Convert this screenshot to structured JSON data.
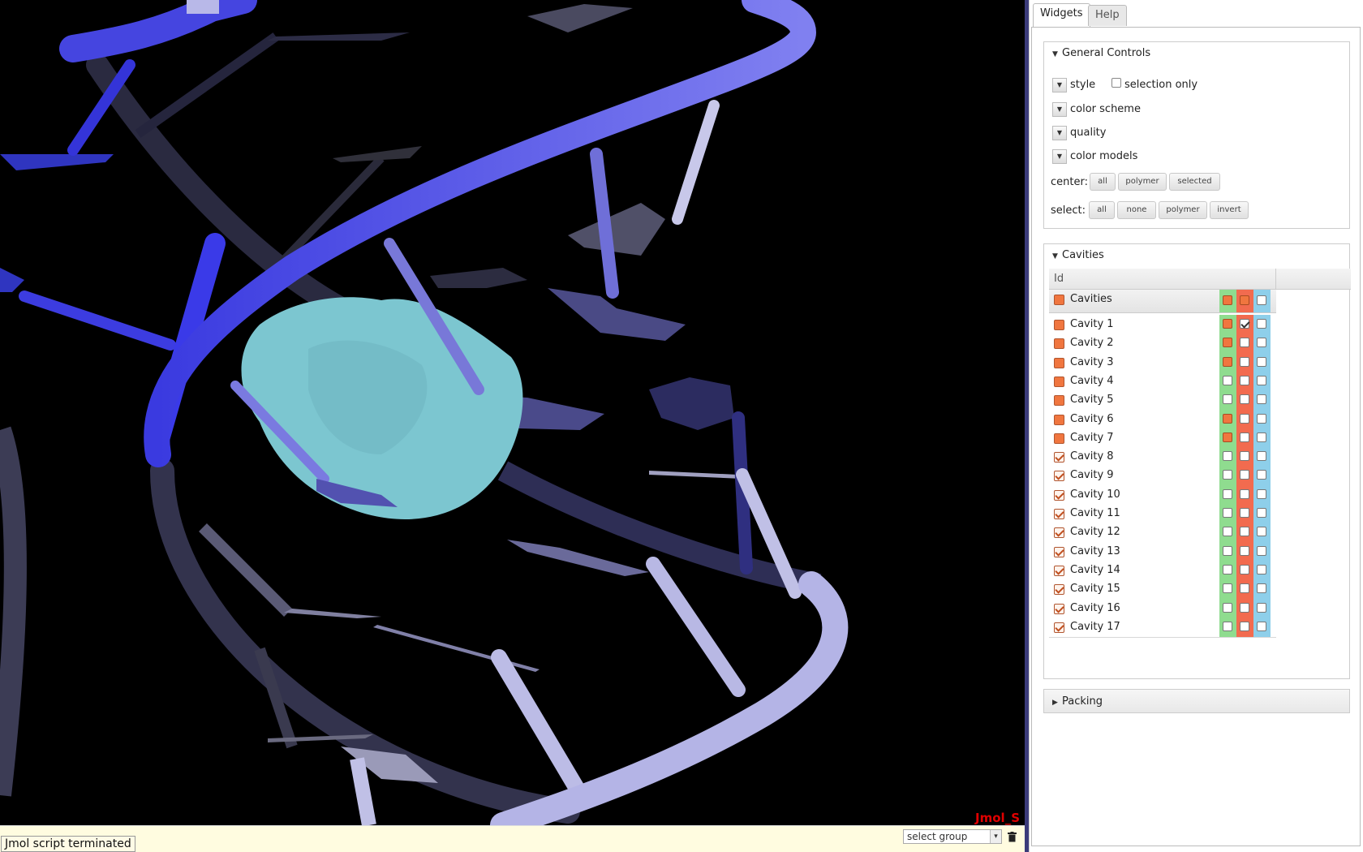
{
  "viewer": {
    "label": "Jmol_S",
    "status": "Jmol script terminated",
    "select_group": "select group"
  },
  "tabs": [
    {
      "label": "Widgets"
    },
    {
      "label": "Help"
    }
  ],
  "general": {
    "title": "General Controls",
    "style_label": "style",
    "selection_only_label": "selection only",
    "color_scheme_label": "color scheme",
    "quality_label": "quality",
    "color_models_label": "color models",
    "center_label": "center:",
    "center_buttons": [
      "all",
      "polymer",
      "selected"
    ],
    "select_label": "select:",
    "select_buttons": [
      "all",
      "none",
      "polymer",
      "invert"
    ]
  },
  "cavities": {
    "title": "Cavities",
    "column_id": "Id",
    "group": {
      "name": "Cavities",
      "visible": false,
      "g": true,
      "r": true,
      "b": false
    },
    "rows": [
      {
        "name": "Cavity 1",
        "visible": false,
        "g": true,
        "r": true,
        "r_tick": true,
        "b": false
      },
      {
        "name": "Cavity 2",
        "visible": false,
        "g": true,
        "r": false,
        "b": false
      },
      {
        "name": "Cavity 3",
        "visible": false,
        "g": true,
        "r": false,
        "b": false
      },
      {
        "name": "Cavity 4",
        "visible": false,
        "g": false,
        "r": false,
        "b": false
      },
      {
        "name": "Cavity 5",
        "visible": false,
        "g": false,
        "r": false,
        "b": false
      },
      {
        "name": "Cavity 6",
        "visible": false,
        "g": true,
        "r": false,
        "b": false
      },
      {
        "name": "Cavity 7",
        "visible": false,
        "g": true,
        "r": false,
        "b": false
      },
      {
        "name": "Cavity 8",
        "visible": true,
        "g": false,
        "r": false,
        "b": false
      },
      {
        "name": "Cavity 9",
        "visible": true,
        "g": false,
        "r": false,
        "b": false
      },
      {
        "name": "Cavity 10",
        "visible": true,
        "g": false,
        "r": false,
        "b": false
      },
      {
        "name": "Cavity 11",
        "visible": true,
        "g": false,
        "r": false,
        "b": false
      },
      {
        "name": "Cavity 12",
        "visible": true,
        "g": false,
        "r": false,
        "b": false
      },
      {
        "name": "Cavity 13",
        "visible": true,
        "g": false,
        "r": false,
        "b": false
      },
      {
        "name": "Cavity 14",
        "visible": true,
        "g": false,
        "r": false,
        "b": false
      },
      {
        "name": "Cavity 15",
        "visible": true,
        "g": false,
        "r": false,
        "b": false
      },
      {
        "name": "Cavity 16",
        "visible": true,
        "g": false,
        "r": false,
        "b": false
      },
      {
        "name": "Cavity 17",
        "visible": true,
        "g": false,
        "r": false,
        "b": false
      }
    ]
  },
  "packing": {
    "title": "Packing"
  }
}
